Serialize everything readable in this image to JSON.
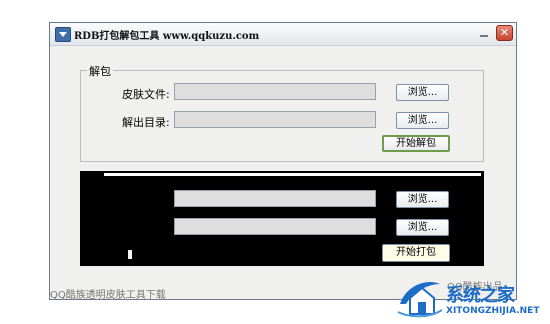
{
  "window": {
    "title": "RDB打包解包工具 www.qqkuzu.com",
    "close_symbol": "✕"
  },
  "unpack": {
    "legend": "解包",
    "skin_file_label": "皮肤文件:",
    "skin_file_value": "",
    "output_dir_label": "解出目录:",
    "output_dir_value": "",
    "browse1_label": "浏览...",
    "browse2_label": "浏览...",
    "start_label": "开始解包"
  },
  "pack": {
    "field1_value": "",
    "field2_value": "",
    "browse1_label": "浏览...",
    "browse2_label": "浏览...",
    "start_label": "开始打包"
  },
  "status": {
    "left_text": "QQ酷族透明皮肤工具下载",
    "right_text": "QQ酷族出品"
  },
  "watermark": {
    "main_text": "系统之家",
    "sub_text": "XITONGZHIJIA.NET",
    "accent_color": "#1d6cc5"
  },
  "icons": [
    "app-icon",
    "minimize-icon",
    "close-icon",
    "watermark-house-icon"
  ]
}
